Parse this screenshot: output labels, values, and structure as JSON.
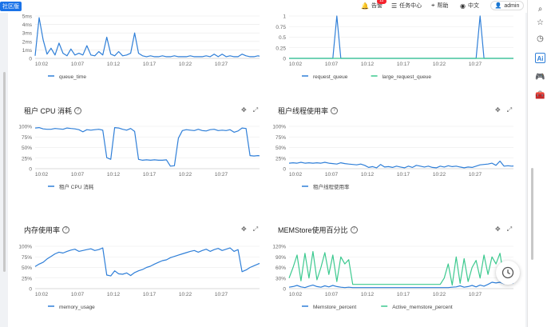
{
  "topbar": {
    "edition": "社区版",
    "alarm_label": "告警",
    "alarm_badge": "12",
    "task_center": "任务中心",
    "help": "帮助",
    "language": "中文",
    "user": "admin"
  },
  "right_rail": {
    "icons": [
      "search-icon",
      "star-icon",
      "clock-history-icon",
      "ai-icon",
      "gamepad-icon",
      "toolbox-icon"
    ]
  },
  "fab": {
    "icon": "clock-icon"
  },
  "colors": {
    "blue": "#2f7fd8",
    "green": "#3cc98f",
    "grid": "#e8e8e8"
  },
  "panels": [
    {
      "id": "queue-time",
      "title": "",
      "legend": [
        "queue_time"
      ],
      "chart_data": {
        "type": "line",
        "x_ticks": [
          "10:02",
          "10:07",
          "10:12",
          "10:17",
          "10:22",
          "10:27"
        ],
        "y_ticks": [
          "0",
          "1ms",
          "2ms",
          "3ms",
          "4ms",
          "5ms"
        ],
        "ylim": [
          0,
          5
        ],
        "series": [
          {
            "name": "queue_time",
            "color": "#2f7fd8",
            "values": [
              0.3,
              4.8,
              2.2,
              0.5,
              1.2,
              0.4,
              1.8,
              0.6,
              0.3,
              1.1,
              0.4,
              0.6,
              0.4,
              1.5,
              0.4,
              0.3,
              0.8,
              0.4,
              2.5,
              0.5,
              0.3,
              0.8,
              0.3,
              0.4,
              0.6,
              3.0,
              0.6,
              0.3,
              0.2,
              0.3,
              0.2,
              0.2,
              0.3,
              0.2,
              0.2,
              0.3,
              0.2,
              0.2,
              0.2,
              0.3,
              0.2,
              0.2,
              0.2,
              0.3,
              0.2,
              0.5,
              0.2,
              0.5,
              0.2,
              0.3,
              0.2,
              0.2,
              0.5,
              0.3,
              0.2,
              0.2,
              0.3,
              0.2
            ]
          }
        ]
      }
    },
    {
      "id": "request-queue",
      "title": "",
      "legend": [
        "request_queue",
        "large_request_queue"
      ],
      "chart_data": {
        "type": "line",
        "x_ticks": [
          "10:02",
          "10:07",
          "10:12",
          "10:17",
          "10:22",
          "10:27"
        ],
        "y_ticks": [
          "0",
          "0.25",
          "0.5",
          "0.75",
          "1"
        ],
        "ylim": [
          0,
          1
        ],
        "series": [
          {
            "name": "request_queue",
            "color": "#2f7fd8",
            "values": [
              0,
              0,
              0,
              0,
              0,
              0,
              0,
              0,
              0,
              0,
              0,
              0,
              1,
              0,
              0,
              0,
              0,
              0,
              0,
              0,
              0,
              0,
              0,
              0,
              0,
              0,
              0,
              0,
              0,
              0,
              0,
              0,
              0,
              0,
              0,
              0,
              0,
              0,
              0,
              0,
              0,
              0,
              0,
              0,
              0,
              0,
              0,
              0,
              1,
              0,
              0,
              0,
              0,
              0,
              0,
              0,
              0,
              0
            ]
          },
          {
            "name": "large_request_queue",
            "color": "#3cc98f",
            "values": [
              0,
              0,
              0,
              0,
              0,
              0,
              0,
              0,
              0,
              0,
              0,
              0,
              0,
              0,
              0,
              0,
              0,
              0,
              0,
              0,
              0,
              0,
              0,
              0,
              0,
              0,
              0,
              0,
              0,
              0,
              0,
              0,
              0,
              0,
              0,
              0,
              0,
              0,
              0,
              0,
              0,
              0,
              0,
              0,
              0,
              0,
              0,
              0,
              0,
              0,
              0,
              0,
              0,
              0,
              0,
              0,
              0,
              0
            ]
          }
        ]
      }
    },
    {
      "id": "tenant-cpu",
      "title": "租户 CPU 消耗",
      "legend": [
        "租户 CPU 消耗"
      ],
      "chart_data": {
        "type": "line",
        "x_ticks": [
          "10:02",
          "10:07",
          "10:12",
          "10:17",
          "10:22",
          "10:27"
        ],
        "y_ticks": [
          "0",
          "25%",
          "50%",
          "75%",
          "100%"
        ],
        "ylim": [
          0,
          100
        ],
        "series": [
          {
            "name": "租户 CPU 消耗",
            "color": "#2f7fd8",
            "values": [
              96,
              97,
              94,
              93,
              93,
              95,
              94,
              93,
              96,
              95,
              94,
              92,
              87,
              92,
              91,
              92,
              93,
              91,
              26,
              22,
              97,
              96,
              93,
              91,
              95,
              88,
              22,
              20,
              21,
              20,
              21,
              20,
              20,
              21,
              6,
              7,
              72,
              90,
              92,
              91,
              90,
              93,
              90,
              89,
              92,
              93,
              90,
              91,
              90,
              92,
              86,
              89,
              96,
              95,
              31,
              30,
              31,
              30
            ]
          }
        ]
      }
    },
    {
      "id": "tenant-thread",
      "title": "租户线程使用率",
      "legend": [
        "租户线程使用率"
      ],
      "chart_data": {
        "type": "line",
        "x_ticks": [
          "10:02",
          "10:07",
          "10:12",
          "10:17",
          "10:22",
          "10:27"
        ],
        "y_ticks": [
          "0",
          "25%",
          "50%",
          "75%",
          "100%"
        ],
        "ylim": [
          0,
          100
        ],
        "series": [
          {
            "name": "租户线程使用率",
            "color": "#2f7fd8",
            "values": [
              13,
              14,
              13,
              15,
              13,
              14,
              13,
              14,
              13,
              15,
              13,
              12,
              11,
              14,
              12,
              11,
              10,
              9,
              11,
              8,
              3,
              5,
              2,
              10,
              4,
              5,
              3,
              6,
              4,
              2,
              6,
              3,
              8,
              6,
              4,
              6,
              3,
              2,
              6,
              4,
              7,
              5,
              6,
              4,
              2,
              4,
              3,
              6,
              9,
              10,
              11,
              13,
              8,
              18,
              6,
              7,
              6,
              7
            ]
          }
        ]
      }
    },
    {
      "id": "memory-usage",
      "title": "内存使用率",
      "legend": [
        "memory_usage"
      ],
      "chart_data": {
        "type": "line",
        "x_ticks": [
          "10:02",
          "10:07",
          "10:12",
          "10:17",
          "10:22",
          "10:27"
        ],
        "y_ticks": [
          "0",
          "25%",
          "50%",
          "75%",
          "100%"
        ],
        "ylim": [
          0,
          100
        ],
        "series": [
          {
            "name": "memory_usage",
            "color": "#2f7fd8",
            "values": [
              52,
              58,
              62,
              70,
              76,
              82,
              86,
              84,
              88,
              91,
              93,
              88,
              90,
              92,
              94,
              90,
              92,
              96,
              32,
              30,
              42,
              35,
              34,
              37,
              31,
              38,
              42,
              45,
              50,
              53,
              58,
              62,
              66,
              68,
              73,
              76,
              79,
              82,
              85,
              88,
              90,
              86,
              90,
              93,
              88,
              92,
              95,
              90,
              93,
              96,
              88,
              92,
              40,
              44,
              50,
              54,
              58,
              62
            ]
          }
        ]
      }
    },
    {
      "id": "memstore",
      "title": "MEMStore使用百分比",
      "legend": [
        "Memstore_percent",
        "Active_memstore_percent"
      ],
      "chart_data": {
        "type": "line",
        "x_ticks": [
          "10:02",
          "10:07",
          "10:12",
          "10:17",
          "10:22",
          "10:27"
        ],
        "y_ticks": [
          "0",
          "30%",
          "60%",
          "90%",
          "120%"
        ],
        "ylim": [
          0,
          120
        ],
        "series": [
          {
            "name": "Memstore_percent",
            "color": "#2f7fd8",
            "values": [
              4,
              6,
              9,
              5,
              3,
              7,
              10,
              6,
              4,
              8,
              5,
              9,
              6,
              4,
              3,
              4,
              3,
              3,
              3,
              3,
              3,
              3,
              3,
              3,
              3,
              3,
              3,
              3,
              3,
              3,
              3,
              3,
              3,
              3,
              3,
              3,
              3,
              3,
              3,
              3,
              3,
              4,
              5,
              8,
              4,
              6,
              9,
              5,
              10,
              7,
              12,
              18,
              16,
              18,
              14,
              16,
              15,
              16
            ]
          },
          {
            "name": "Active_memstore_percent",
            "color": "#3cc98f",
            "values": [
              30,
              60,
              95,
              22,
              100,
              30,
              105,
              25,
              60,
              102,
              40,
              95,
              20,
              90,
              70,
              82,
              12,
              12,
              12,
              12,
              12,
              12,
              12,
              12,
              12,
              12,
              12,
              12,
              12,
              12,
              12,
              12,
              12,
              12,
              12,
              12,
              12,
              12,
              12,
              30,
              70,
              10,
              90,
              15,
              85,
              20,
              60,
              80,
              30,
              95,
              40,
              90,
              70,
              100,
              30,
              26,
              28,
              26
            ]
          }
        ]
      }
    }
  ]
}
